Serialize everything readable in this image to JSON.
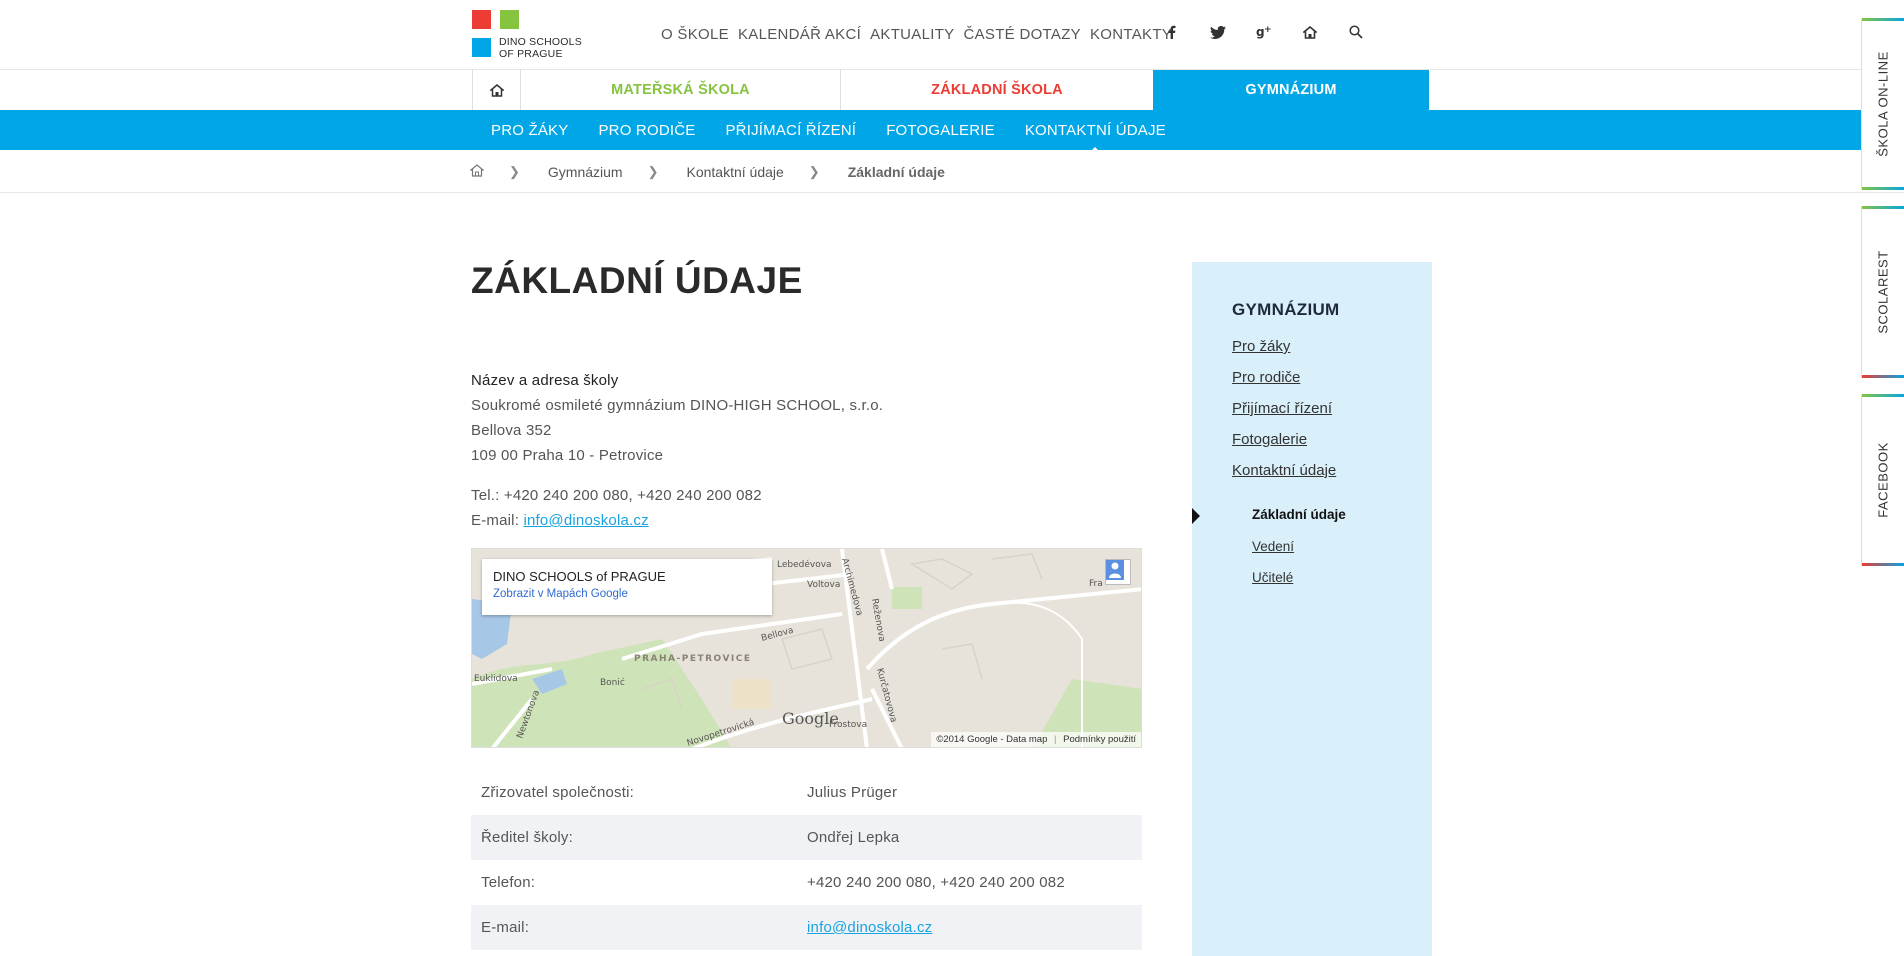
{
  "header": {
    "logo_line1": "DINO SCHOOLS",
    "logo_line2": "OF PRAGUE",
    "nav": [
      "O ŠKOLE",
      "KALENDÁŘ AKCÍ",
      "AKTUALITY",
      "ČASTÉ DOTAZY",
      "KONTAKTY"
    ],
    "social_icons": [
      "facebook-icon",
      "twitter-icon",
      "google-plus-icon",
      "house-icon",
      "search-icon"
    ]
  },
  "school_tabs": {
    "ms": "MATEŘSKÁ ŠKOLA",
    "zs": "ZÁKLADNÍ ŠKOLA",
    "gym": "GYMNÁZIUM"
  },
  "subnav": [
    "PRO ŽÁKY",
    "PRO RODIČE",
    "PŘIJÍMACÍ ŘÍZENÍ",
    "FOTOGALERIE",
    "KONTAKTNÍ ÚDAJE"
  ],
  "breadcrumb": {
    "items": [
      "Gymnázium",
      "Kontaktní údaje"
    ],
    "current": "Základní údaje"
  },
  "main": {
    "title": "ZÁKLADNÍ ÚDAJE",
    "address_label": "Název a adresa školy",
    "address_lines": [
      "Soukromé osmileté gymnázium DINO-HIGH SCHOOL, s.r.o.",
      "Bellova 352",
      "109 00 Praha 10 - Petrovice"
    ],
    "tel_line": "Tel.: +420 240 200 080, +420 240 200 082",
    "email_prefix": "E-mail: ",
    "email": "info@dinoskola.cz"
  },
  "map": {
    "card_title": "DINO SCHOOLS of PRAGUE",
    "card_link": "Zobrazit v Mapách Google",
    "labels": [
      "Lebedévova",
      "Voltova",
      "Archimedova",
      "Reženova",
      "Bellova",
      "PRAHA-PETROVICE",
      "Euklidova",
      "Bonić",
      "Newtonova",
      "Novopetrovická",
      "Frostova",
      "Kurčatovova",
      "Fra"
    ],
    "google": "Google",
    "copyright": "©2014 Google - Data map",
    "terms": "Podmínky použití"
  },
  "contact_table": [
    {
      "label": "Zřizovatel společnosti:",
      "value": "Julius Prüger"
    },
    {
      "label": "Ředitel školy:",
      "value": "Ondřej Lepka"
    },
    {
      "label": "Telefon:",
      "value": "+420 240 200 080, +420 240 200 082"
    },
    {
      "label": "E-mail:",
      "value": "info@dinoskola.cz"
    }
  ],
  "sidebar": {
    "title": "GYMNÁZIUM",
    "items": [
      "Pro žáky",
      "Pro rodiče",
      "Přijímací řízení",
      "Fotogalerie",
      "Kontaktní údaje"
    ],
    "subitems": [
      "Základní údaje",
      "Vedení",
      "Učitelé"
    ]
  },
  "right_tabs": [
    "ŠKOLA ON-LINE",
    "SCOLAREST",
    "FACEBOOK"
  ],
  "colors": {
    "accent_blue": "#00a6e6",
    "green": "#86c440",
    "red": "#ec3c33",
    "sidebar_bg": "#d9effa"
  }
}
